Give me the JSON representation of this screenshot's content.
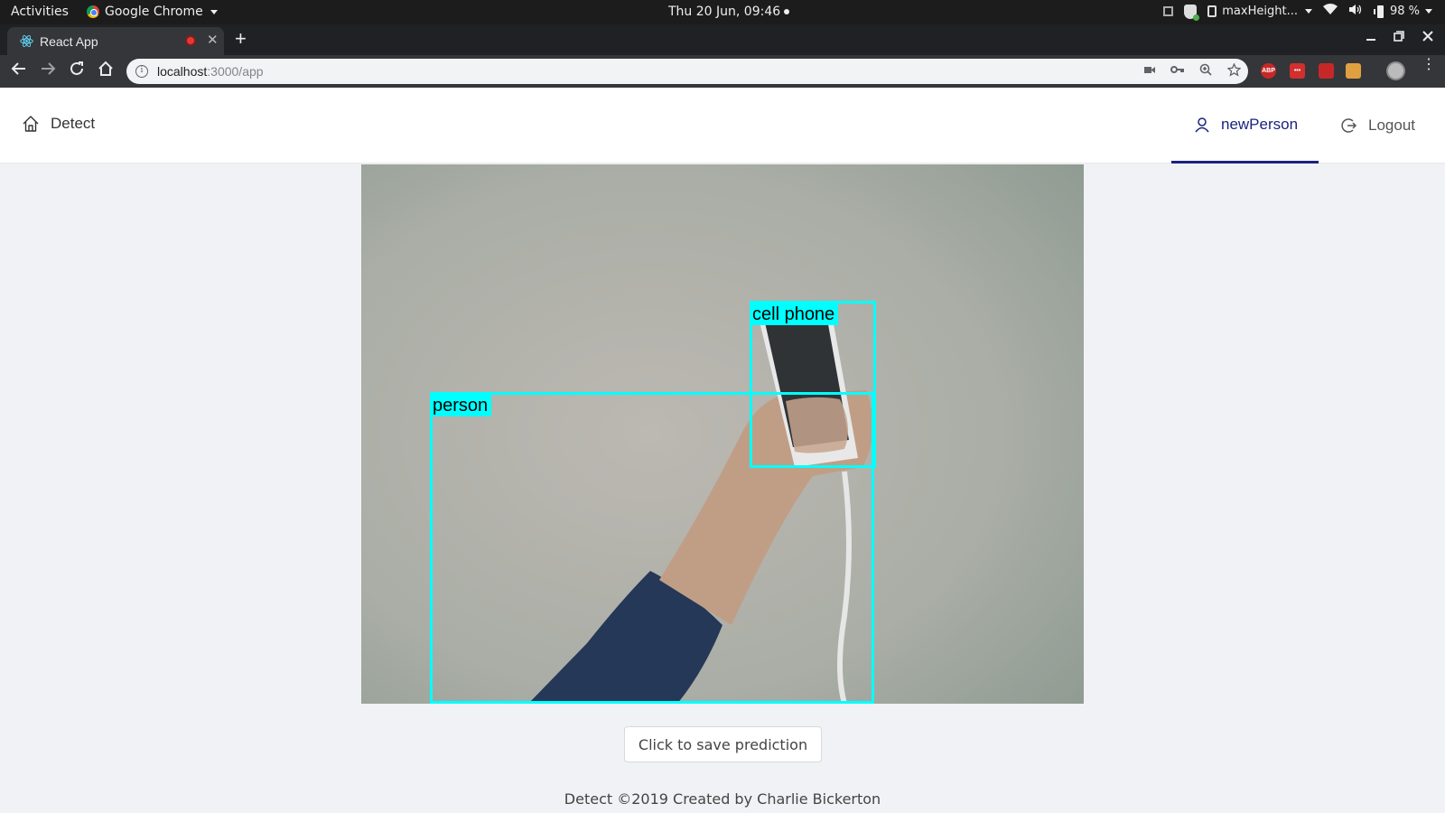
{
  "system_bar": {
    "activities": "Activities",
    "app_name": "Google Chrome",
    "clock": "Thu 20 Jun, 09:46",
    "window_title": "maxHeight...",
    "battery": "98 %"
  },
  "browser": {
    "tab_title": "React App",
    "url_host": "localhost",
    "url_path": ":3000/app"
  },
  "header": {
    "brand": "Detect",
    "user_label": "newPerson",
    "logout_label": "Logout",
    "active_color": "#1a237e"
  },
  "detections": [
    {
      "label": "cell phone"
    },
    {
      "label": "person"
    }
  ],
  "box_color": "#00ffff",
  "save_button": "Click to save prediction",
  "footer": "Detect ©2019 Created by Charlie Bickerton"
}
